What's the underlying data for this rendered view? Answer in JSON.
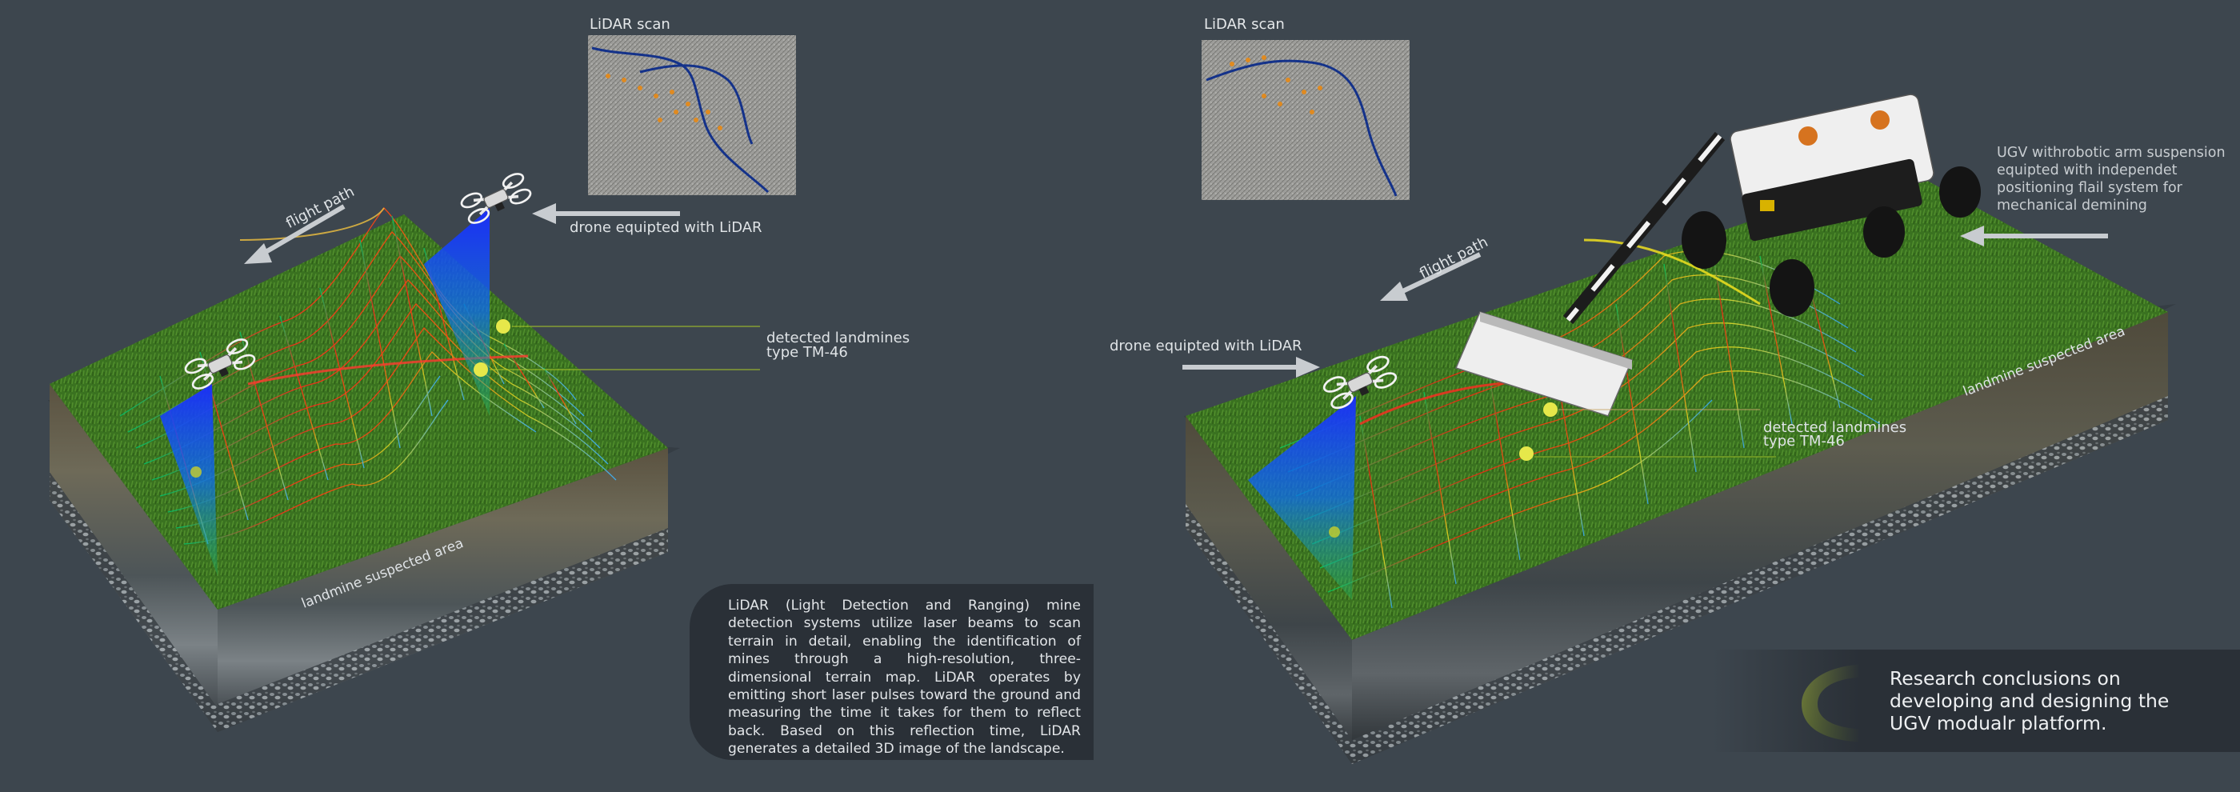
{
  "left_panel": {
    "scan_title": "LiDAR scan",
    "flight_path_label": "flight path",
    "drone_label": "drone equipted with LiDAR",
    "detected_label_line1": "detected landmines",
    "detected_label_line2": "type TM-46",
    "area_label": "landmine suspected area",
    "info_text": "LiDAR (Light Detection and Ranging) mine detection systems utilize laser beams to scan terrain in detail, enabling the identification of mines through a high-resolution, three-dimensional terrain map. LiDAR operates by emitting short laser pulses toward the ground and measuring the time it takes for them to reflect back. Based on this reflection time, LiDAR generates a detailed 3D image of the landscape."
  },
  "right_panel": {
    "scan_title": "LiDAR scan",
    "flight_path_label": "flight path",
    "drone_label": "drone equipted with LiDAR",
    "detected_label_line1": "detected landmines",
    "detected_label_line2": "type TM-46",
    "area_label": "landmine suspected area",
    "ugv_label_lines": [
      "UGV withrobotic arm suspension",
      "equipted with independet",
      "positioning flail system for",
      "mechanical demining"
    ]
  },
  "conclusion": {
    "lines": [
      "Research conclusions on",
      "developing and designing the",
      "UGV modualr platform."
    ]
  },
  "colors": {
    "background": "#3d464e",
    "panel": "#2a3037",
    "accent": "#a6c32a",
    "mine": "#e6e84a",
    "laser": "#1a2cff"
  }
}
